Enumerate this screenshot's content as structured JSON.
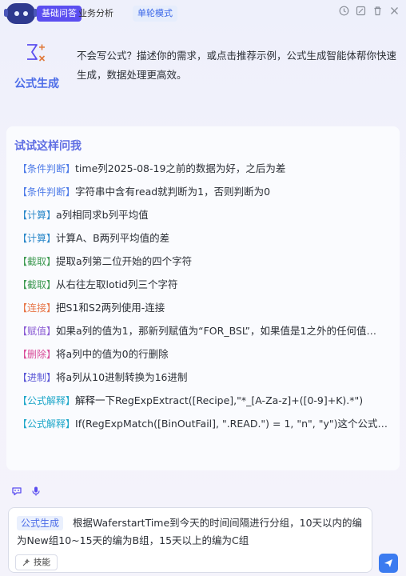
{
  "header": {
    "tabs": [
      {
        "label": "基础问答",
        "active": true
      },
      {
        "label": "业务分析",
        "active": false
      },
      {
        "label": "单轮模式",
        "active": false
      }
    ],
    "icons": [
      "history-icon",
      "new-chat-icon",
      "delete-icon",
      "close-icon"
    ]
  },
  "intro": {
    "name": "公式生成",
    "description": "不会写公式？描述你的需求，或点击推荐示例，公式生成智能体帮你快速生成，数据处理更高效。"
  },
  "suggestions": {
    "title": "试试这样问我",
    "items": [
      {
        "tag": "【条件判断】",
        "text": "time列2025-08-19之前的数据为好，之后为差",
        "kind": "cond"
      },
      {
        "tag": "【条件判断】",
        "text": "字符串中含有read就判断为1，否则判断为0",
        "kind": "cond"
      },
      {
        "tag": "【计算】",
        "text": "a列相同求b列平均值",
        "kind": "calc"
      },
      {
        "tag": "【计算】",
        "text": "计算A、B两列平均值的差",
        "kind": "calc"
      },
      {
        "tag": "【截取】",
        "text": "提取a列第二位开始的四个字符",
        "kind": "cut"
      },
      {
        "tag": "【截取】",
        "text": "从右往左取lotid列三个字符",
        "kind": "cut"
      },
      {
        "tag": "【连接】",
        "text": "把S1和S2两列使用-连接",
        "kind": "join"
      },
      {
        "tag": "【赋值】",
        "text": "如果a列的值为1，那新列赋值为“FOR_BSL”，如果值是1之外的任何值…",
        "kind": "assign"
      },
      {
        "tag": "【删除】",
        "text": "将a列中的值为0的行删除",
        "kind": "del"
      },
      {
        "tag": "【进制】",
        "text": "将a列从10进制转换为16进制",
        "kind": "base"
      },
      {
        "tag": "【公式解释】",
        "text": "解释一下RegExpExtract([Recipe],\"*_[A-Za-z]+([0-9]+K).*\")",
        "kind": "explain"
      },
      {
        "tag": "【公式解释】",
        "text": "If(RegExpMatch([BinOutFail], \".READ.\") = 1, \"n\", \"y\")这个公式是什…",
        "kind": "explain"
      }
    ]
  },
  "composer": {
    "chip": "公式生成",
    "value": "根据WaferstartTime到今天的时间间隔进行分组，10天以内的编为New组10~15天的编为B组，15天以上的编为C组",
    "skill_label": "技能"
  },
  "colors": {
    "accent": "#5b4ef0",
    "link": "#4d6de8",
    "send": "#3b7bf0"
  }
}
